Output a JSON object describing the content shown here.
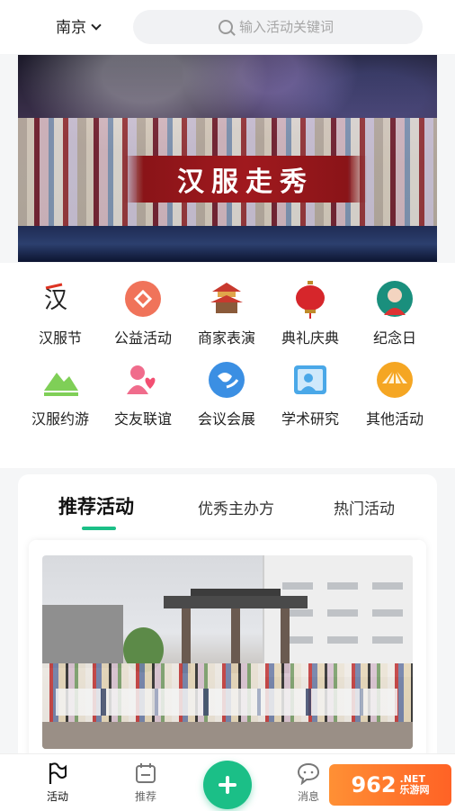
{
  "header": {
    "city": "南京",
    "search_placeholder": "输入活动关键词"
  },
  "banner": {
    "title": "汉服走秀",
    "dots": 3,
    "active_dot": 1
  },
  "categories": [
    {
      "label": "汉服节",
      "icon": "hanfu-calligraphy-icon"
    },
    {
      "label": "公益活动",
      "icon": "charity-heart-icon"
    },
    {
      "label": "商家表演",
      "icon": "pavilion-icon"
    },
    {
      "label": "典礼庆典",
      "icon": "lantern-icon"
    },
    {
      "label": "纪念日",
      "icon": "portrait-icon"
    },
    {
      "label": "汉服约游",
      "icon": "mountain-icon"
    },
    {
      "label": "交友联谊",
      "icon": "friends-heart-icon"
    },
    {
      "label": "会议会展",
      "icon": "globe-chat-icon"
    },
    {
      "label": "学术研究",
      "icon": "research-board-icon"
    },
    {
      "label": "其他活动",
      "icon": "fan-icon"
    }
  ],
  "tabs": [
    {
      "label": "推荐活动",
      "active": true
    },
    {
      "label": "优秀主办方",
      "active": false
    },
    {
      "label": "热门活动",
      "active": false
    }
  ],
  "tabbar": [
    {
      "label": "活动",
      "icon": "flag-icon",
      "active": true
    },
    {
      "label": "推荐",
      "icon": "calendar-icon",
      "active": false
    },
    {
      "label": "消息",
      "icon": "chat-bubble-icon",
      "active": false
    }
  ],
  "watermark": {
    "text": "962",
    "tld": ".NET",
    "sub": "乐游网"
  },
  "colors": {
    "accent": "#1bbf87"
  }
}
